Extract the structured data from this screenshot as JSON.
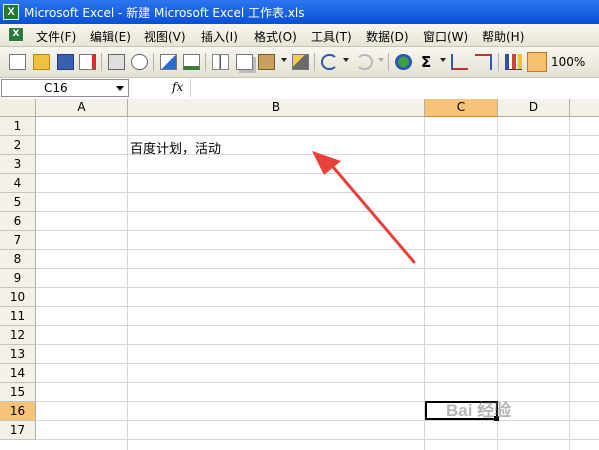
{
  "window": {
    "title": "Microsoft Excel - 新建 Microsoft Excel 工作表.xls",
    "app_badge": "X"
  },
  "menu": {
    "doc_badge": "X",
    "items": [
      "文件(F)",
      "编辑(E)",
      "视图(V)",
      "插入(I)",
      "格式(O)",
      "工具(T)",
      "数据(D)",
      "窗口(W)",
      "帮助(H)"
    ]
  },
  "toolbar": {
    "zoom": "100%",
    "sum_symbol": "Σ"
  },
  "formula_bar": {
    "cell_ref": "C16",
    "fx_label": "fx",
    "content": ""
  },
  "sheet": {
    "columns": [
      "A",
      "B",
      "C",
      "D"
    ],
    "rows": [
      "1",
      "2",
      "3",
      "4",
      "5",
      "6",
      "7",
      "8",
      "9",
      "10",
      "11",
      "12",
      "13",
      "14",
      "15",
      "16",
      "17"
    ],
    "active_cell": "C16",
    "cells": {
      "B2": "百度计划，活动"
    }
  },
  "watermark": "Bai 经验",
  "colors": {
    "accent": "#0a4fd6",
    "active_header": "#f7c27a",
    "arrow": "#e8403a"
  }
}
